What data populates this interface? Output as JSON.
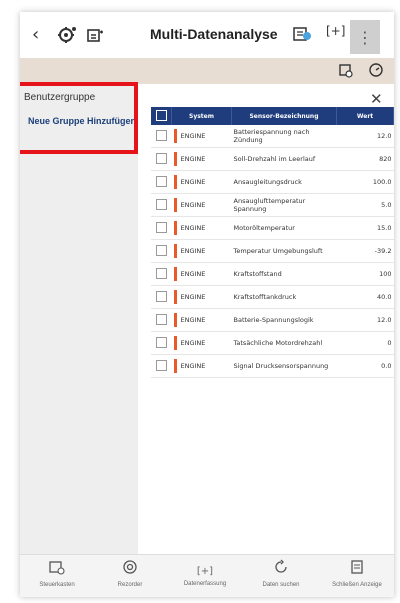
{
  "header": {
    "title": "Multi-Datenanalyse"
  },
  "sidebar": {
    "heading": "Benutzergruppe",
    "add_group": "Neue Gruppe Hinzufügen"
  },
  "table": {
    "columns": [
      "System",
      "Sensor-Bezeichnung",
      "Wert"
    ],
    "rows": [
      {
        "system": "ENGINE",
        "name": "Batteriespannung nach Zündung",
        "value": "12.0"
      },
      {
        "system": "ENGINE",
        "name": "Soll-Drehzahl im Leerlauf",
        "value": "820"
      },
      {
        "system": "ENGINE",
        "name": "Ansaugleitungsdruck",
        "value": "100.0"
      },
      {
        "system": "ENGINE",
        "name": "Ansauglufttemperatur Spannung",
        "value": "5.0"
      },
      {
        "system": "ENGINE",
        "name": "Motoröltemperatur",
        "value": "15.0"
      },
      {
        "system": "ENGINE",
        "name": "Temperatur Umgebungsluft",
        "value": "-39.2"
      },
      {
        "system": "ENGINE",
        "name": "Kraftstoffstand",
        "value": "100"
      },
      {
        "system": "ENGINE",
        "name": "Kraftstofftankdruck",
        "value": "40.0"
      },
      {
        "system": "ENGINE",
        "name": "Batterie-Spannungslogik",
        "value": "12.0"
      },
      {
        "system": "ENGINE",
        "name": "Tatsächliche Motordrehzahl",
        "value": "0"
      },
      {
        "system": "ENGINE",
        "name": "Signal Drucksensorspannung",
        "value": "0.0"
      }
    ]
  },
  "bottom_tabs": [
    {
      "label": "Steuerkasten",
      "icon": "battery-icon"
    },
    {
      "label": "Rezorder",
      "icon": "record-icon"
    },
    {
      "label": "Datenerfassung",
      "icon": "capture-icon"
    },
    {
      "label": "Daten suchen",
      "icon": "refresh-icon"
    },
    {
      "label": "Schließen Anzeige",
      "icon": "document-icon"
    }
  ]
}
